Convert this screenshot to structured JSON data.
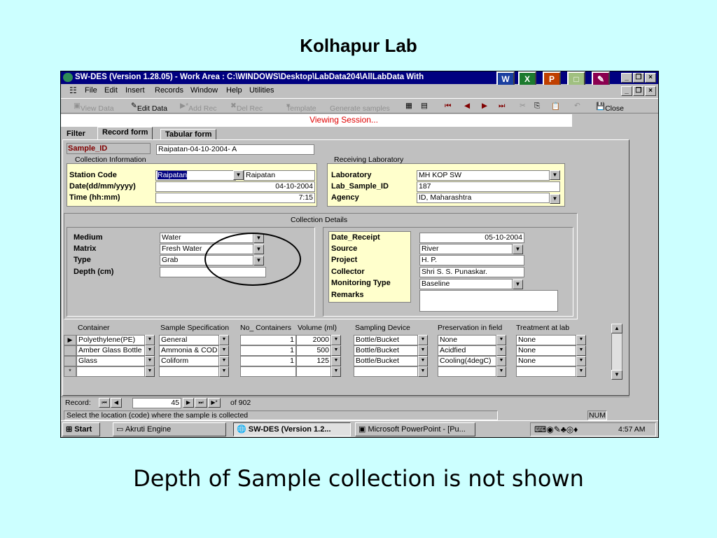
{
  "slide": {
    "title": "Kolhapur Lab",
    "caption": "Depth of Sample collection is not shown"
  },
  "window": {
    "title": "SW-DES (Version 1.28.05) - Work Area : C:\\WINDOWS\\Desktop\\LabData204\\AllLabData With",
    "title_bg": "#000080"
  },
  "menu": [
    "File",
    "Edit",
    "Insert",
    "Records",
    "Window",
    "Help",
    "Utilities"
  ],
  "toolbar": {
    "view_data": "View Data",
    "edit_data": "Edit Data",
    "add_rec": "Add Rec",
    "del_rec": "Del Rec",
    "template": "Template",
    "generate": "Generate samples",
    "close": "Close"
  },
  "status_banner": "Viewing Session...",
  "tabs": {
    "filter": "Filter",
    "record_form": "Record form",
    "tabular_form": "Tabular form"
  },
  "sample": {
    "label": "Sample_ID",
    "value": "Raipatan-04-10-2004- A",
    "collection_info": "Collection Information",
    "receiving_lab": "Receiving Laboratory"
  },
  "station": {
    "station_code_label": "Station Code",
    "station_code_value": "Raipatan",
    "station_name": "Raipatan",
    "date_label": "Date(dd/mm/yyyy)",
    "date_value": "04-10-2004",
    "time_label": "Time (hh:mm)",
    "time_value": "7:15"
  },
  "lab": {
    "laboratory_label": "Laboratory",
    "laboratory_value": "MH KOP SW",
    "lab_sample_label": "Lab_Sample_ID",
    "lab_sample_value": "187",
    "agency_label": "Agency",
    "agency_value": "ID, Maharashtra"
  },
  "collection_details": "Collection Details",
  "medium": {
    "medium_label": "Medium",
    "medium_value": "Water",
    "matrix_label": "Matrix",
    "matrix_value": "Fresh Water",
    "type_label": "Type",
    "type_value": "Grab",
    "depth_label": "Depth (cm)",
    "depth_value": ""
  },
  "receipt": {
    "date_receipt_label": "Date_Receipt",
    "date_receipt_value": "05-10-2004",
    "source_label": "Source",
    "source_value": "River",
    "project_label": "Project",
    "project_value": "H. P.",
    "collector_label": "Collector",
    "collector_value": "Shri S. S. Punaskar.",
    "monitoring_label": "Monitoring Type",
    "monitoring_value": "Baseline",
    "remarks_label": "Remarks",
    "remarks_value": ""
  },
  "grid": {
    "headers": [
      "Container",
      "Sample Specification",
      "No_ Containers",
      "Volume (ml)",
      "Sampling Device",
      "Preservation in field",
      "Treatment at lab"
    ],
    "rows": [
      [
        "Polyethylene(PE)",
        "General",
        "1",
        "2000",
        "Bottle/Bucket",
        "None",
        "None"
      ],
      [
        "Amber Glass Bottle",
        "Ammonia & COD",
        "1",
        "500",
        "Bottle/Bucket",
        "Acidfied",
        "None"
      ],
      [
        "Glass",
        "Coliform",
        "1",
        "125",
        "Bottle/Bucket",
        "Cooling(4degC)",
        "None"
      ]
    ],
    "new_row_marker": "*",
    "current_marker": "▶"
  },
  "record_nav": {
    "label": "Record:",
    "current": "45",
    "of_label": "of  902"
  },
  "statusbar": {
    "text": "Select the location (code) where the sample is collected",
    "num": "NUM"
  },
  "taskbar": {
    "start": "Start",
    "item1": "Akruti Engine",
    "item2": "SW-DES (Version 1.2...",
    "item3": "Microsoft PowerPoint - [Pu...",
    "clock": "4:57 AM"
  }
}
